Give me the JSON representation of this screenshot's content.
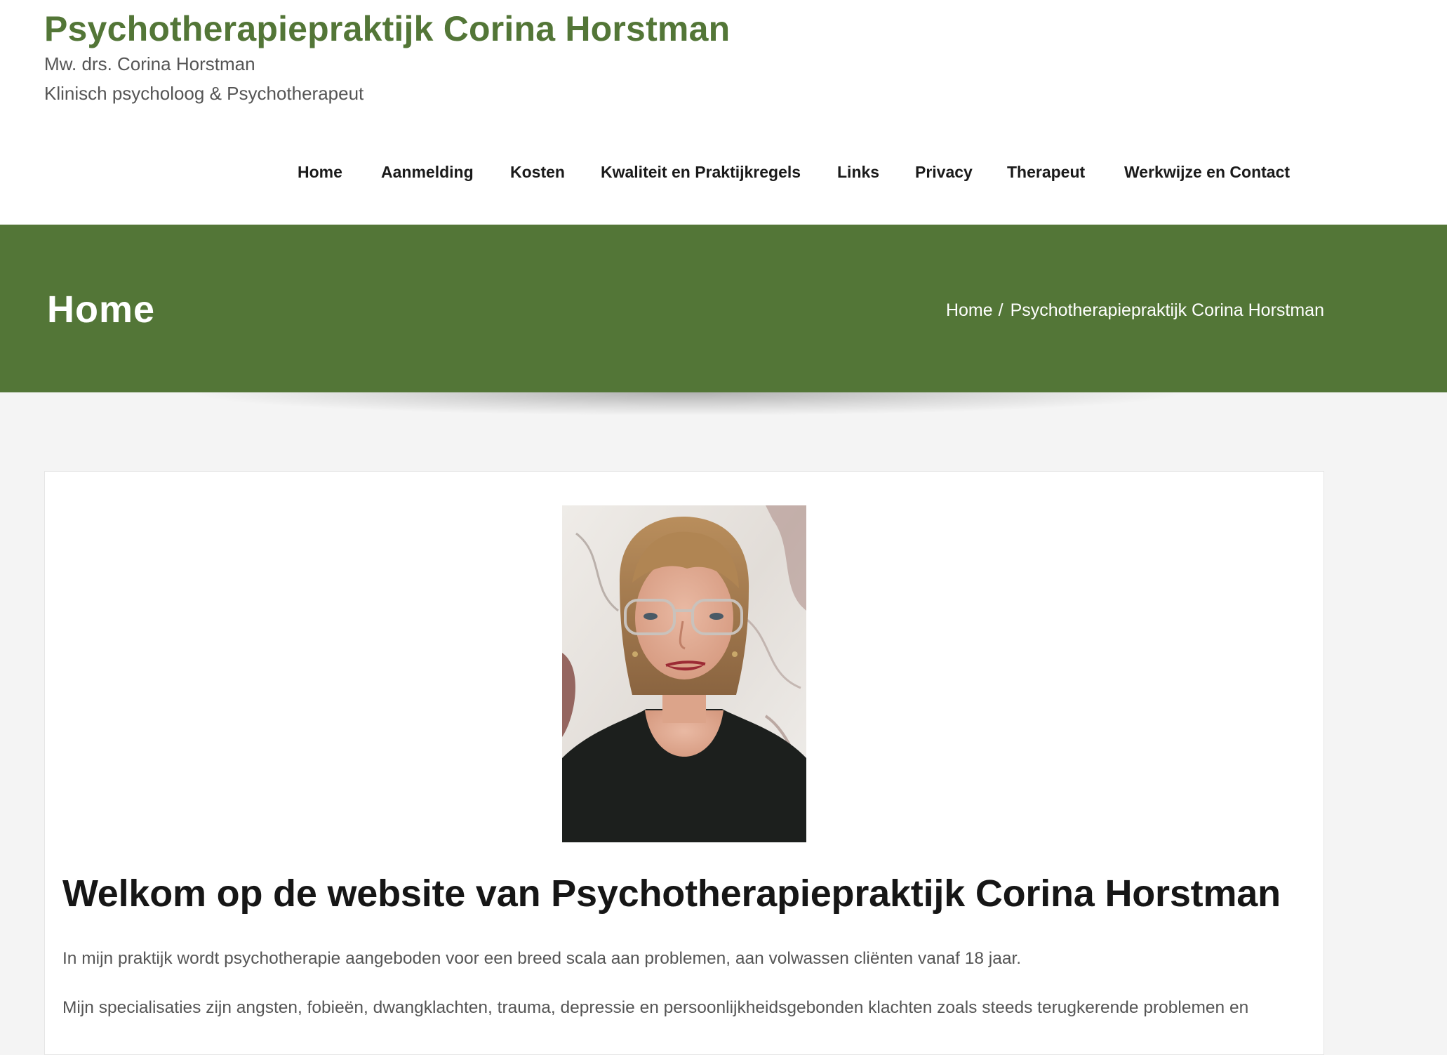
{
  "header": {
    "site_title": "Psychotherapiepraktijk Corina Horstman",
    "tagline_line1": "Mw. drs. Corina Horstman",
    "tagline_line2": "Klinisch psycholoog & Psychotherapeut"
  },
  "nav": {
    "items": [
      {
        "label": "Home"
      },
      {
        "label": "Aanmelding"
      },
      {
        "label": "Kosten"
      },
      {
        "label": "Kwaliteit en Praktijkregels"
      },
      {
        "label": "Links"
      },
      {
        "label": "Privacy"
      },
      {
        "label": "Therapeut"
      },
      {
        "label": "Werkwijze en Contact"
      }
    ]
  },
  "banner": {
    "title": "Home",
    "breadcrumb": {
      "home": "Home",
      "separator": "/",
      "current": "Psychotherapiepraktijk Corina Horstman"
    }
  },
  "content": {
    "heading": "Welkom op de website van Psychotherapiepraktijk Corina Horstman",
    "paragraph1": "In mijn praktijk wordt psychotherapie aangeboden voor een breed scala aan problemen, aan volwassen cliënten vanaf 18 jaar.",
    "paragraph2_line1": "Mijn specialisaties zijn angsten, fobieën, dwangklachten, trauma, depressie en persoonlijkheidsgebonden klachten zoals steeds terugkerende problemen en"
  },
  "colors": {
    "brand_green": "#537637",
    "page_background": "#f4f4f4",
    "text_dark": "#1a1a1a",
    "text_muted": "#555555"
  }
}
